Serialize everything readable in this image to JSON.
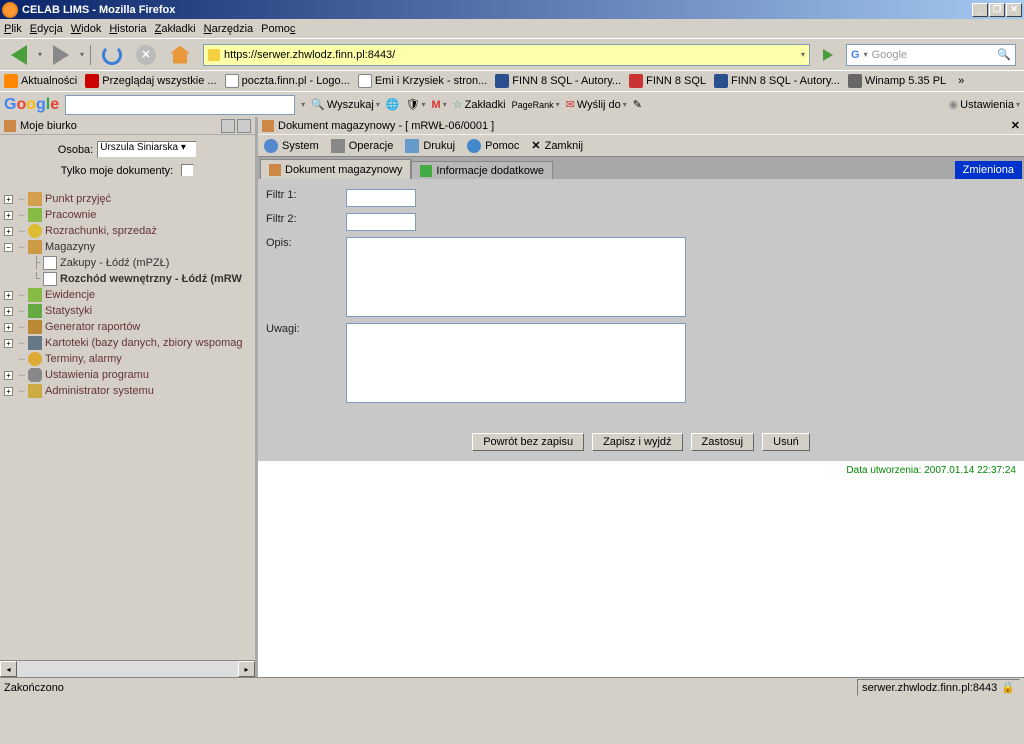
{
  "window": {
    "title": "CELAB LIMS - Mozilla Firefox"
  },
  "menubar": {
    "plik": "Plik",
    "edycja": "Edycja",
    "widok": "Widok",
    "historia": "Historia",
    "zakladki": "Zakładki",
    "narzedzia": "Narzędzia",
    "pomoc": "Pomoc"
  },
  "url": "https://serwer.zhwlodz.finn.pl:8443/",
  "search_placeholder": "Google",
  "bookmarks": {
    "b1": "Aktualności",
    "b2": "Przeglądaj wszystkie ...",
    "b3": "poczta.finn.pl - Logo...",
    "b4": "Emi i Krzysiek - stron...",
    "b5": "FINN 8 SQL - Autory...",
    "b6": "FINN 8 SQL",
    "b7": "FINN 8 SQL - Autory...",
    "b8": "Winamp 5.35 PL"
  },
  "googlebar": {
    "wyszukaj": "Wyszukaj",
    "zakladki": "Zakładki",
    "pagerank": "PageRank",
    "wyslij": "Wyślij do",
    "ustawienia": "Ustawienia"
  },
  "sidebar": {
    "title": "Moje biurko",
    "osoba_label": "Osoba:",
    "osoba_value": "Urszula Siniarska",
    "tylko_moje": "Tylko moje dokumenty:",
    "items": {
      "punkt": "Punkt przyjęć",
      "pracownie": "Pracownie",
      "rozrachunki": "Rozrachunki, sprzedaż",
      "magazyny": "Magazyny",
      "zakupy": "Zakupy - Łódź (mPZŁ)",
      "rozchod": "Rozchód wewnętrzny - Łódź (mRW",
      "ewidencje": "Ewidencje",
      "statystyki": "Statystyki",
      "generator": "Generator raportów",
      "kartoteki": "Kartoteki (bazy danych, zbiory wspomag",
      "terminy": "Terminy, alarmy",
      "ustawienia": "Ustawienia programu",
      "admin": "Administrator systemu"
    }
  },
  "document": {
    "title": "Dokument magazynowy - [ mRWŁ-06/0001 ]",
    "menu": {
      "system": "System",
      "operacje": "Operacje",
      "drukuj": "Drukuj",
      "pomoc": "Pomoc",
      "zamknij": "Zamknij"
    },
    "tabs": {
      "t1": "Dokument magazynowy",
      "t2": "Informacje dodatkowe"
    },
    "status": "Zmieniona",
    "form": {
      "filtr1": "Filtr 1:",
      "filtr2": "Filtr 2:",
      "opis": "Opis:",
      "uwagi": "Uwagi:"
    },
    "buttons": {
      "powrot": "Powrót bez zapisu",
      "zapisz": "Zapisz i wyjdź",
      "zastosuj": "Zastosuj",
      "usun": "Usuń"
    },
    "creation": "Data utworzenia: 2007.01.14 22:37:24"
  },
  "statusbar": {
    "left": "Zakończono",
    "right": "serwer.zhwlodz.finn.pl:8443"
  }
}
